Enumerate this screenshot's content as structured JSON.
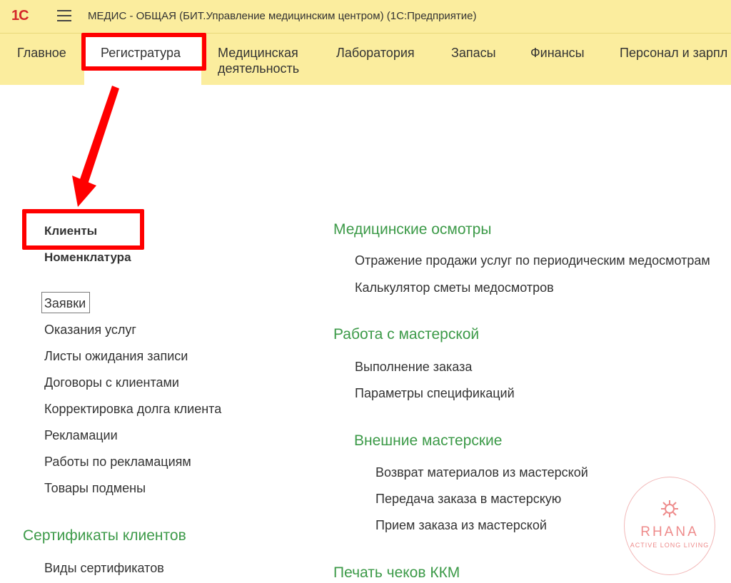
{
  "app": {
    "logo_text": "1С",
    "title": "МЕДИС - ОБЩАЯ (БИТ.Управление медицинским центром)  (1С:Предприятие)"
  },
  "menu": {
    "items": [
      {
        "label": "Главное"
      },
      {
        "label": "Регистратура",
        "active": true
      },
      {
        "label": "Медицинская деятельность"
      },
      {
        "label": "Лаборатория"
      },
      {
        "label": "Запасы"
      },
      {
        "label": "Финансы"
      },
      {
        "label": "Персонал и зарпл"
      }
    ]
  },
  "left": {
    "bold_items": [
      "Клиенты",
      "Номенклатура"
    ],
    "items": [
      "Заявки",
      "Оказания услуг",
      "Листы ожидания записи",
      "Договоры с клиентами",
      "Корректировка долга клиента",
      "Рекламации",
      "Работы по рекламациям",
      "Товары подмены"
    ],
    "section_certs": {
      "title": "Сертификаты клиентов",
      "items": [
        "Виды сертификатов"
      ]
    }
  },
  "right": {
    "section_med": {
      "title": "Медицинские осмотры",
      "items": [
        "Отражение продажи услуг по периодическим медосмотрам",
        "Калькулятор сметы медосмотров"
      ]
    },
    "section_workshop": {
      "title": "Работа с мастерской",
      "items": [
        "Выполнение заказа",
        "Параметры спецификаций"
      ]
    },
    "section_external": {
      "title": "Внешние мастерские",
      "items": [
        "Возврат материалов из мастерской",
        "Передача заказа в мастерскую",
        "Прием заказа из мастерской"
      ]
    },
    "section_kkm": {
      "title": "Печать чеков ККМ"
    }
  },
  "watermark": {
    "name": "RHANA",
    "tagline": "ACTIVE LONG LIVING"
  },
  "colors": {
    "bar": "#fbed9e",
    "section_green": "#3c9a48",
    "highlight_red": "#ff0000"
  }
}
